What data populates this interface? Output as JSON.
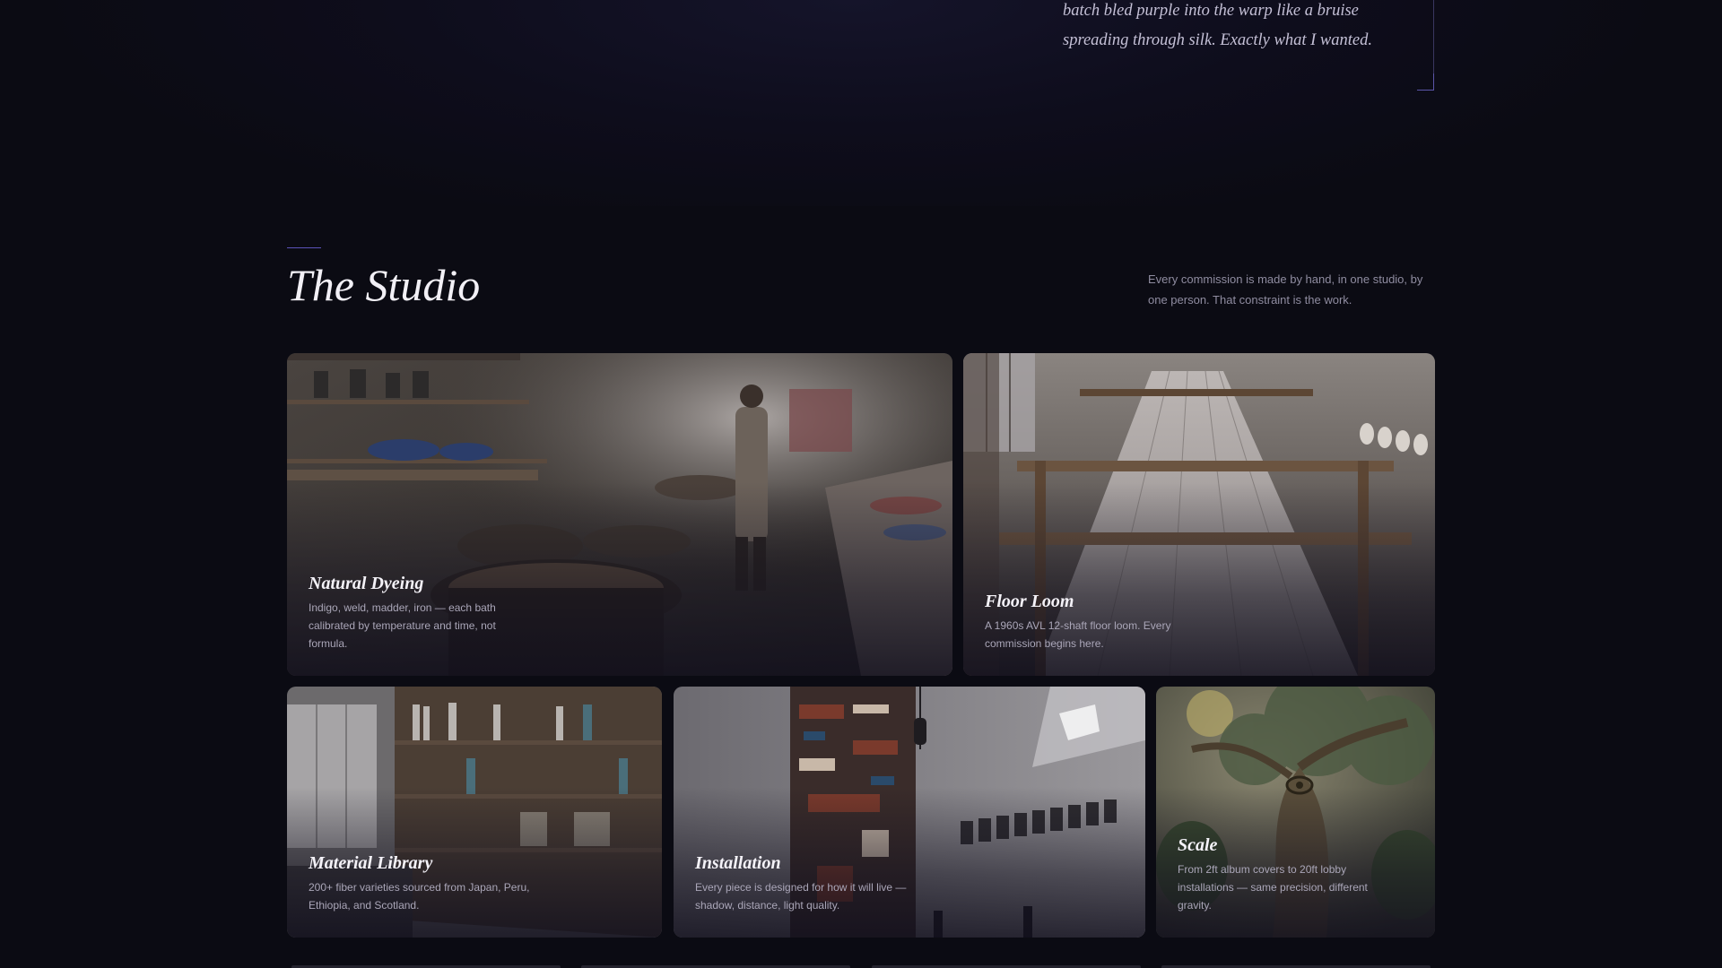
{
  "testimonial": {
    "text": "batch bled purple into the warp like a bruise spreading through silk. Exactly what I wanted."
  },
  "studio": {
    "title": "The Studio",
    "description": "Every commission is made by hand, in one studio, by one person. That constraint is the work."
  },
  "cards": [
    {
      "title": "Natural Dyeing",
      "description": "Indigo, weld, madder, iron — each bath calibrated by temperature and time, not formula."
    },
    {
      "title": "Floor Loom",
      "description": "A 1960s AVL 12-shaft floor loom. Every commission begins here."
    },
    {
      "title": "Material Library",
      "description": "200+ fiber varieties sourced from Japan, Peru, Ethiopia, and Scotland."
    },
    {
      "title": "Installation",
      "description": "Every piece is designed for how it will live — shadow, distance, light quality."
    },
    {
      "title": "Scale",
      "description": "From 2ft album covers to 20ft lobby installations — same precision, different gravity."
    }
  ],
  "colors": {
    "background": "#0b0b13",
    "accent": "#5a52b8",
    "text_muted": "#8f8ca0"
  }
}
